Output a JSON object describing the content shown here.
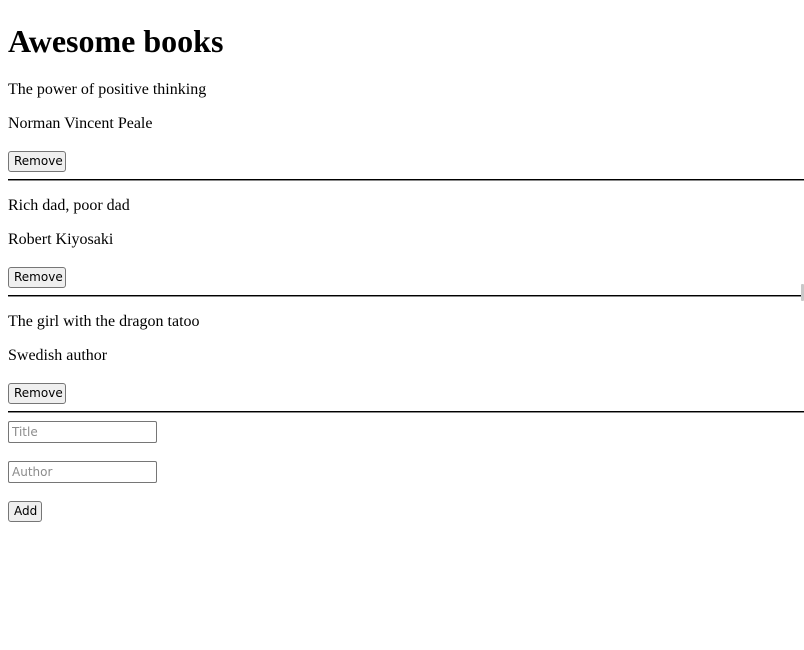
{
  "page": {
    "heading": "Awesome books"
  },
  "books": [
    {
      "title": "The power of positive thinking",
      "author": "Norman Vincent Peale",
      "remove_label": "Remove"
    },
    {
      "title": "Rich dad, poor dad",
      "author": "Robert Kiyosaki",
      "remove_label": "Remove"
    },
    {
      "title": "The girl with the dragon tatoo",
      "author": "Swedish author",
      "remove_label": "Remove"
    }
  ],
  "form": {
    "title_placeholder": "Title",
    "title_value": "",
    "author_placeholder": "Author",
    "author_value": "",
    "add_label": "Add"
  }
}
